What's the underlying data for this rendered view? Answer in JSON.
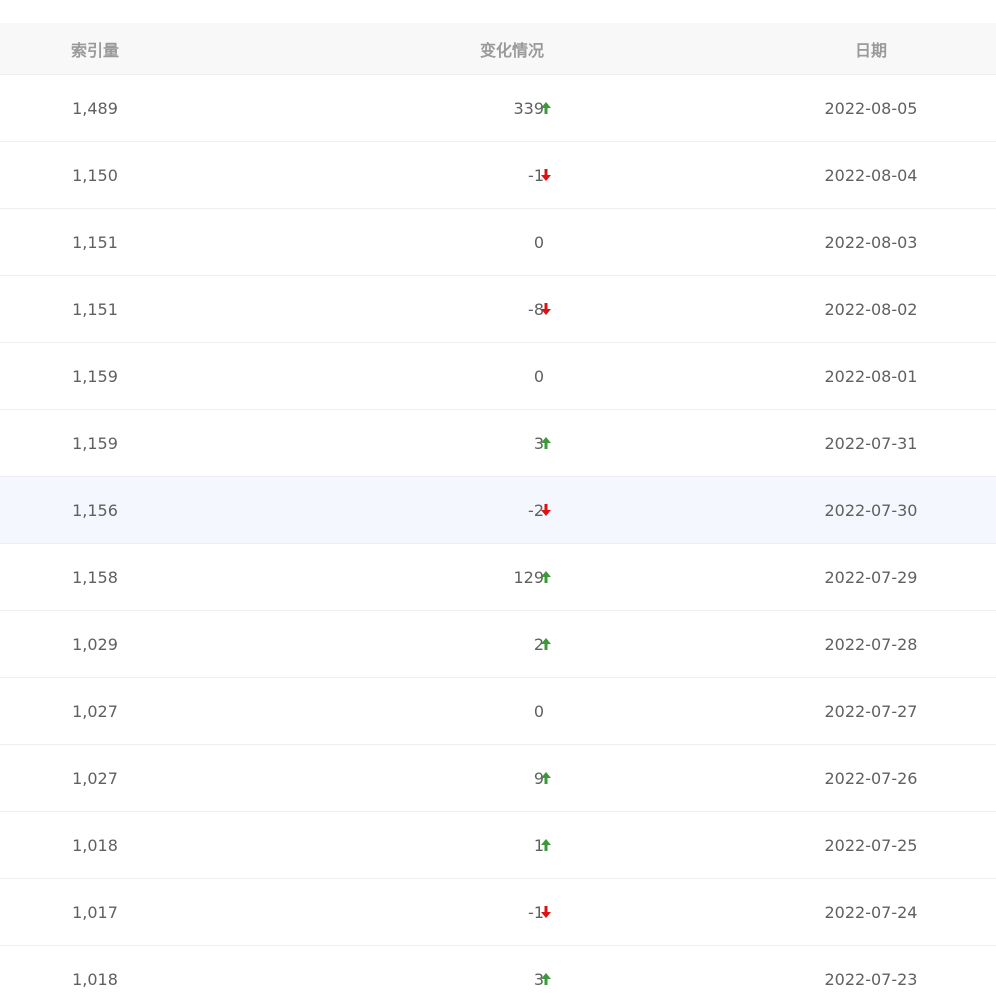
{
  "table": {
    "headers": {
      "index": "索引量",
      "change": "变化情况",
      "date": "日期"
    },
    "colors": {
      "up": "#3a9a3a",
      "down": "#e01010"
    },
    "rows": [
      {
        "index": "1,489",
        "change": "339",
        "dir": "up",
        "date": "2022-08-05"
      },
      {
        "index": "1,150",
        "change": "-1",
        "dir": "down",
        "date": "2022-08-04"
      },
      {
        "index": "1,151",
        "change": "0",
        "dir": "none",
        "date": "2022-08-03"
      },
      {
        "index": "1,151",
        "change": "-8",
        "dir": "down",
        "date": "2022-08-02"
      },
      {
        "index": "1,159",
        "change": "0",
        "dir": "none",
        "date": "2022-08-01"
      },
      {
        "index": "1,159",
        "change": "3",
        "dir": "up",
        "date": "2022-07-31"
      },
      {
        "index": "1,156",
        "change": "-2",
        "dir": "down",
        "date": "2022-07-30",
        "highlighted": true
      },
      {
        "index": "1,158",
        "change": "129",
        "dir": "up",
        "date": "2022-07-29"
      },
      {
        "index": "1,029",
        "change": "2",
        "dir": "up",
        "date": "2022-07-28"
      },
      {
        "index": "1,027",
        "change": "0",
        "dir": "none",
        "date": "2022-07-27"
      },
      {
        "index": "1,027",
        "change": "9",
        "dir": "up",
        "date": "2022-07-26"
      },
      {
        "index": "1,018",
        "change": "1",
        "dir": "up",
        "date": "2022-07-25"
      },
      {
        "index": "1,017",
        "change": "-1",
        "dir": "down",
        "date": "2022-07-24"
      },
      {
        "index": "1,018",
        "change": "3",
        "dir": "up",
        "date": "2022-07-23"
      }
    ]
  }
}
